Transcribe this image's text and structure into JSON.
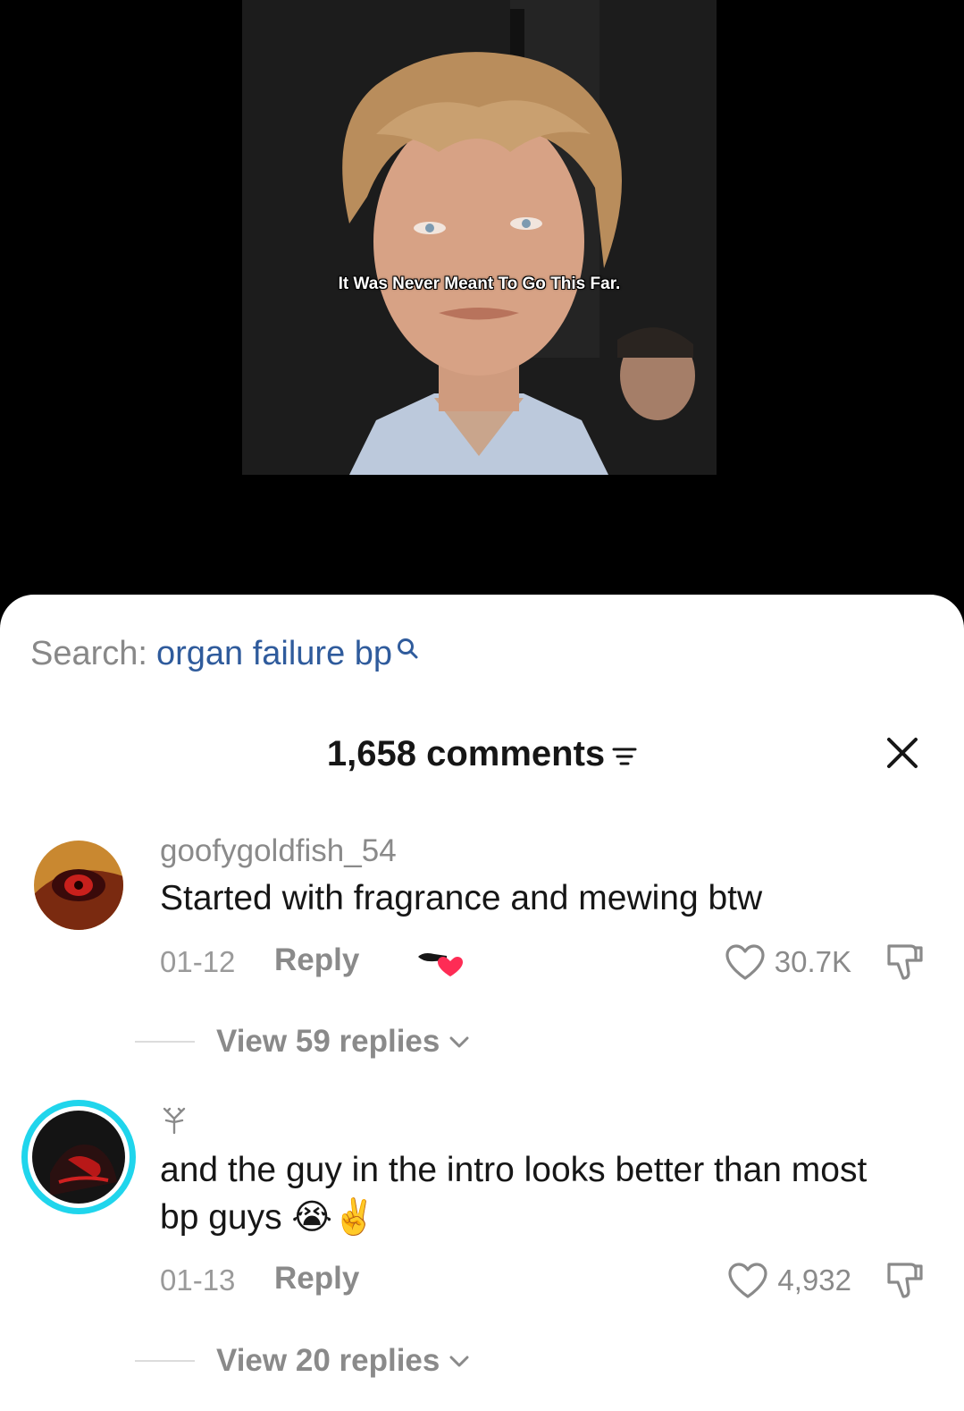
{
  "video": {
    "caption": "It Was Never Meant To Go This Far."
  },
  "search": {
    "prefix": "Search:",
    "query": "organ failure bp",
    "icon": "search-icon"
  },
  "comments_header": {
    "count_label": "1,658 comments",
    "sort_icon": "sort-icon",
    "close_icon": "close-icon"
  },
  "comments": [
    {
      "username": "goofygoldfish_54",
      "text": "Started with fragrance and mewing btw",
      "date": "01-12",
      "reply_label": "Reply",
      "liked_by_creator": true,
      "likes": "30.7K",
      "view_replies": "View 59 replies"
    },
    {
      "username_icon": "tree-glyph",
      "text": "and the guy in the intro looks better than most bp guys 😭✌️",
      "date": "01-13",
      "reply_label": "Reply",
      "likes": "4,932",
      "view_replies": "View 20 replies",
      "avatar_ring_color": "#20d5ec"
    }
  ],
  "colors": {
    "search_query": "#2f5b9c",
    "creator_heart": "#fe2c55"
  }
}
